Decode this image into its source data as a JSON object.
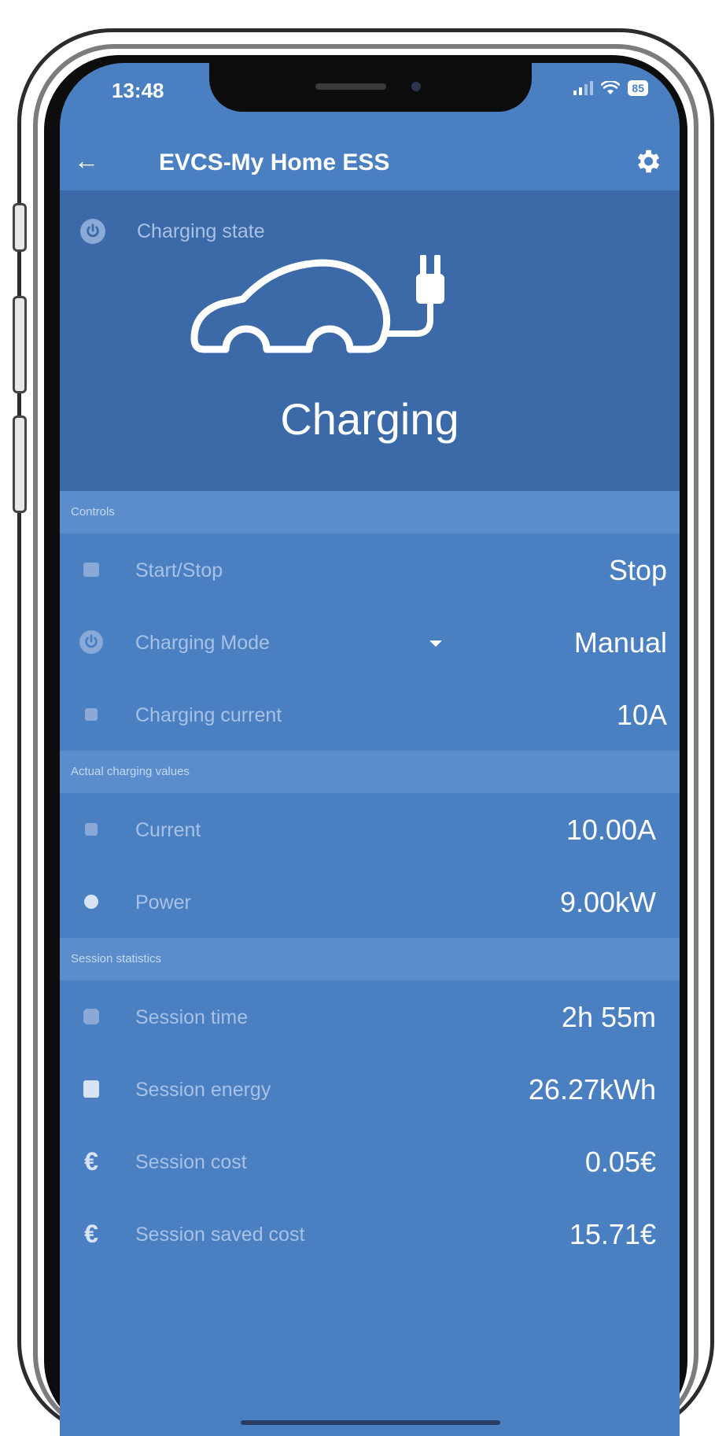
{
  "status_bar": {
    "time": "13:48",
    "battery": "85"
  },
  "app_bar": {
    "title": "EVCS-My Home ESS",
    "back_icon": "arrow-left-icon",
    "settings_icon": "gear-icon"
  },
  "hero": {
    "label": "Charging state",
    "status": "Charging",
    "icon": "power-icon",
    "illustration": "car-plug-icon"
  },
  "sections": {
    "controls": {
      "header": "Controls",
      "start_stop": {
        "label": "Start/Stop",
        "value": "Stop"
      },
      "charging_mode": {
        "label": "Charging Mode",
        "value": "Manual"
      },
      "charging_current": {
        "label": "Charging current",
        "value": "10A"
      }
    },
    "actual": {
      "header": "Actual charging values",
      "current": {
        "label": "Current",
        "value": "10.00A"
      },
      "power": {
        "label": "Power",
        "value": "9.00kW"
      }
    },
    "session": {
      "header": "Session statistics",
      "time": {
        "label": "Session time",
        "value": "2h 55m"
      },
      "energy": {
        "label": "Session energy",
        "value": "26.27kWh"
      },
      "cost": {
        "label": "Session cost",
        "value": "0.05€"
      },
      "saved_cost": {
        "label": "Session saved cost",
        "value": "15.71€"
      }
    }
  },
  "colors": {
    "primary": "#4a7fc2",
    "hero_bg": "#3c69a8",
    "section_bg": "#5b8dcc",
    "label_text": "#a8c1e4"
  }
}
